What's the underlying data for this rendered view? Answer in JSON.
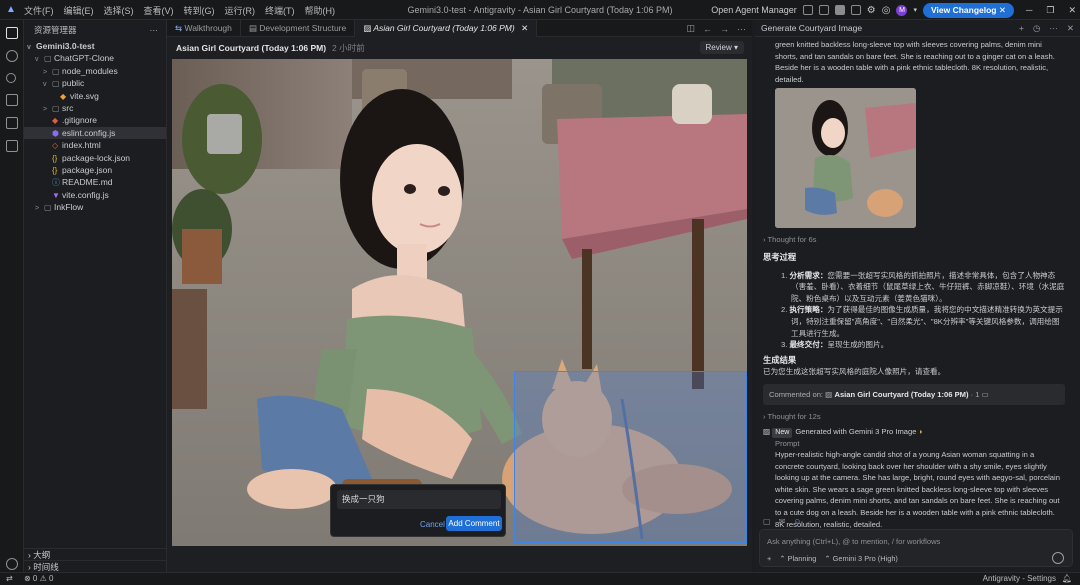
{
  "titlebar": {
    "menus": [
      "文件(F)",
      "编辑(E)",
      "选择(S)",
      "查看(V)",
      "转到(G)",
      "运行(R)",
      "终端(T)",
      "帮助(H)"
    ],
    "window_title": "Gemini3.0-test - Antigravity - Asian Girl Courtyard (Today 1:06 PM)",
    "agent_manager": "Open Agent Manager",
    "view_changelog": "View Changelog",
    "avatar_letter": "M"
  },
  "explorer": {
    "title": "资源管理器",
    "root": "Gemini3.0-test",
    "items": [
      {
        "name": "ChatGPT-Clone",
        "depth": 1,
        "chevron": "v",
        "icon": "folder"
      },
      {
        "name": "node_modules",
        "depth": 2,
        "chevron": ">",
        "icon": "folder"
      },
      {
        "name": "public",
        "depth": 2,
        "chevron": "v",
        "icon": "folder"
      },
      {
        "name": "vite.svg",
        "depth": 3,
        "chevron": "",
        "icon": "svg"
      },
      {
        "name": "src",
        "depth": 2,
        "chevron": ">",
        "icon": "folder"
      },
      {
        "name": ".gitignore",
        "depth": 2,
        "chevron": "",
        "icon": "git"
      },
      {
        "name": "eslint.config.js",
        "depth": 2,
        "chevron": "",
        "icon": "eslint"
      },
      {
        "name": "index.html",
        "depth": 2,
        "chevron": "",
        "icon": "html"
      },
      {
        "name": "package-lock.json",
        "depth": 2,
        "chevron": "",
        "icon": "json"
      },
      {
        "name": "package.json",
        "depth": 2,
        "chevron": "",
        "icon": "json"
      },
      {
        "name": "README.md",
        "depth": 2,
        "chevron": "",
        "icon": "md"
      },
      {
        "name": "vite.config.js",
        "depth": 2,
        "chevron": "",
        "icon": "vite"
      },
      {
        "name": "InkFlow",
        "depth": 1,
        "chevron": ">",
        "icon": "folder"
      }
    ],
    "selected_index": 6,
    "footer": [
      "大纲",
      "时间线"
    ]
  },
  "tabs": [
    {
      "label": "Walkthrough",
      "active": false
    },
    {
      "label": "Development Structure",
      "active": false
    },
    {
      "label": "Asian Girl Courtyard (Today 1:06 PM)",
      "active": true
    }
  ],
  "breadcrumb": {
    "title": "Asian Girl Courtyard (Today 1:06 PM)",
    "time": "2 小时前"
  },
  "review_label": "Review",
  "comment_box": {
    "value": "换成一只狗",
    "cancel": "Cancel",
    "add": "Add Comment"
  },
  "chat": {
    "header": "Generate Courtyard Image",
    "prompt_tail": "green knitted backless long-sleeve top with sleeves covering palms, denim mini shorts, and tan sandals on bare feet. She is reaching out to a ginger cat on a leash. Beside her is a wooden table with a pink ethnic tablecloth. 8K resolution, realistic, detailed.",
    "thought1": "Thought for 6s",
    "thinking_title": "思考过程",
    "steps": [
      {
        "b": "分析需求：",
        "t": "您需要一张超写实风格的抓拍照片，描述非常具体，包含了人物神态（害羞、卧看）、衣着细节（鼠尾草绿上衣、牛仔短裤、赤脚凉鞋）、环境（水泥庭院、粉色桌布）以及互动元素（姜黄色猫咪）。"
      },
      {
        "b": "执行策略：",
        "t": "为了获得最佳的图像生成质量，我将您的中文描述精准转换为英文提示词，特别注重保留\"高角度\"、\"自然柔光\"、\"8K分辨率\"等关键风格参数，调用绘图工具进行生成。"
      },
      {
        "b": "最终交付：",
        "t": "呈现生成的图片。"
      }
    ],
    "result_title": "生成结果",
    "result_text": "已为您生成这张超写实风格的庭院人像照片，请查看。",
    "commented_on": "Commented on:",
    "commented_target": "Asian Girl Courtyard (Today 1:06 PM)",
    "commented_count": "1",
    "thought2": "Thought for 12s",
    "new_badge": "New",
    "generated_with": "Generated with Gemini 3 Pro Image",
    "prompt_label": "Prompt",
    "prompt_text": "Hyper-realistic high-angle candid shot of a young Asian woman squatting in a concrete courtyard, looking back over her shoulder with a shy smile, eyes slightly looking up at the camera. She has large, bright, round eyes with aegyo-sal, porcelain white skin. She wears a sage green knitted backless long-sleeve top with sleeves covering palms, denim mini shorts, and tan sandals on bare feet. She is reaching out to a cute dog on a leash. Beside her is a wooden table with a pink ethnic tablecloth. 8K resolution, realistic, detailed."
  },
  "chat_input": {
    "placeholder": "Ask anything (Ctrl+L), @ to mention, / for workflows",
    "mode": "Planning",
    "model": "Gemini 3 Pro (High)"
  },
  "status": {
    "left": "⊗ 0 ⚠ 0",
    "right": "Antigravity - Settings"
  }
}
